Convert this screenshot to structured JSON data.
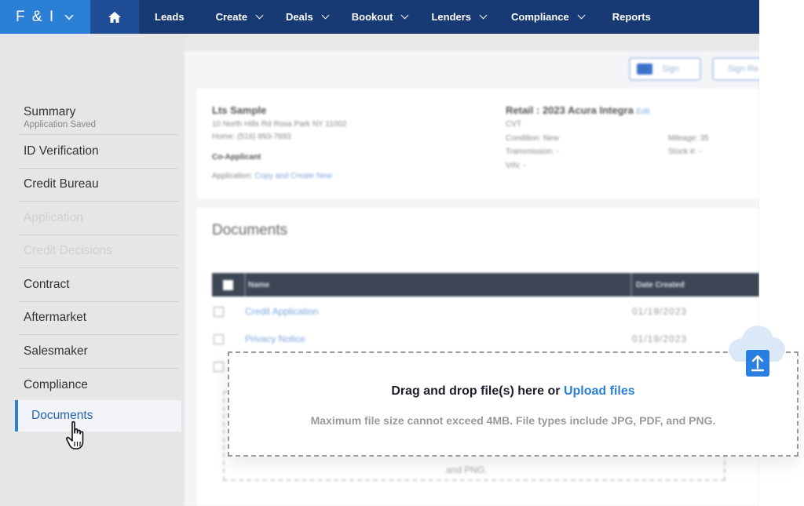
{
  "topnav": {
    "brand": "F & I",
    "items": [
      {
        "label": "Leads",
        "dropdown": false
      },
      {
        "label": "Create",
        "dropdown": true
      },
      {
        "label": "Deals",
        "dropdown": true
      },
      {
        "label": "Bookout",
        "dropdown": true
      },
      {
        "label": "Lenders",
        "dropdown": true
      },
      {
        "label": "Compliance",
        "dropdown": true
      },
      {
        "label": "Reports",
        "dropdown": false
      }
    ]
  },
  "sidebar": {
    "summary_label": "Summary",
    "summary_sub": "Application Saved",
    "items": [
      {
        "label": "ID Verification",
        "disabled": false
      },
      {
        "label": "Credit Bureau",
        "disabled": false
      },
      {
        "label": "Application",
        "disabled": true
      },
      {
        "label": "Credit Decisions",
        "disabled": true
      },
      {
        "label": "Contract",
        "disabled": false
      },
      {
        "label": "Aftermarket",
        "disabled": false
      },
      {
        "label": "Salesmaker",
        "disabled": false
      },
      {
        "label": "Compliance",
        "disabled": false
      }
    ],
    "active_label": "Documents"
  },
  "toolbar": {
    "sign_label": "Sign",
    "sign_remote_label": "Sign Re"
  },
  "customer": {
    "name": "Lts Sample",
    "address": "10 North Hills Rd Rosa Park NY 11002",
    "home_label": "Home:",
    "home_value": "(516) 893-7693",
    "coapplicant_label": "Co-Applicant",
    "application_label": "Application:",
    "application_link": "Copy and Create New"
  },
  "vehicle": {
    "title": "Retail : 2023 Acura Integra",
    "edit_link": "Edit",
    "trim": "CVT",
    "condition": "Condition: New",
    "transmission": "Transmission: -",
    "vin": "VIN: -",
    "mileage": "Mileage: 35",
    "stock": "Stock #: -"
  },
  "documents": {
    "title": "Documents",
    "col_name": "Name",
    "col_date": "Date Created",
    "rows": [
      {
        "name": "Credit Application",
        "date": "01/19/2023"
      },
      {
        "name": "Privacy Notice",
        "date": "01/19/2023"
      }
    ],
    "ghost_text": "and PNG."
  },
  "dropzone": {
    "title_prefix": "Drag and drop file(s) here or",
    "upload_link": "Upload files",
    "subtitle": "Maximum file size cannot exceed 4MB. File types include JPG, PDF, and PNG."
  },
  "colors": {
    "nav_bg": "#173a75",
    "brand_bg": "#2b7fd4",
    "accent": "#2b7fd4",
    "upload_icon": "#2a7de1"
  },
  "icons": {
    "home": "home-icon",
    "upload": "cloud-upload-icon",
    "cursor": "hand-pointer-icon"
  }
}
